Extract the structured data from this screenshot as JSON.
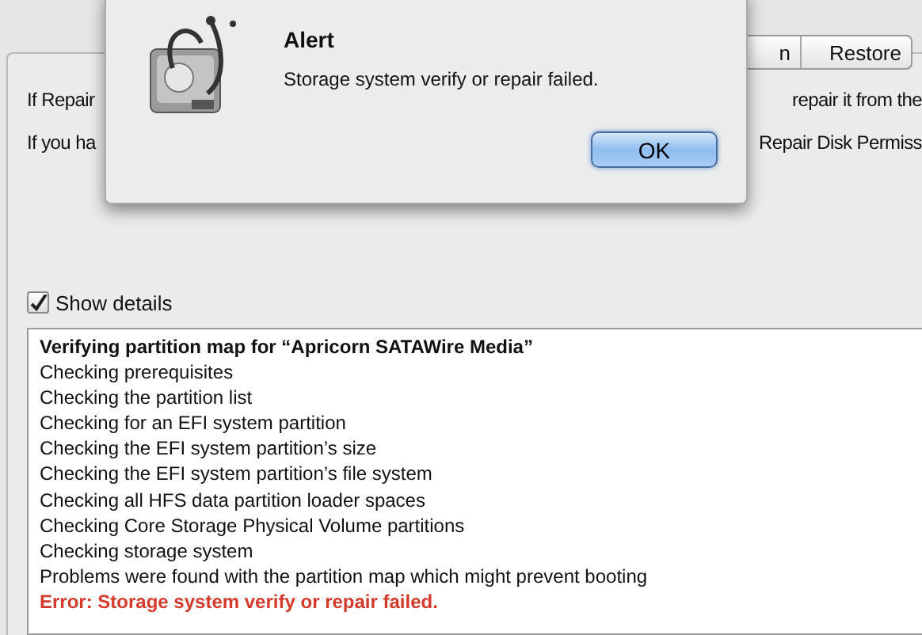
{
  "tabs": [
    {
      "label": "n",
      "selected": false
    },
    {
      "label": "Restore",
      "selected": false
    }
  ],
  "instructions": [
    {
      "left": "If Repair",
      "right": "repair it from the"
    },
    {
      "left": "If you ha",
      "right": "Repair Disk Permiss"
    }
  ],
  "show_details": {
    "label": "Show details",
    "checked": true
  },
  "log": [
    {
      "kind": "heading",
      "text": "Verifying partition map for “Apricorn SATAWire Media”"
    },
    {
      "kind": "normal",
      "text": "Checking prerequisites"
    },
    {
      "kind": "normal",
      "text": "Checking the partition list"
    },
    {
      "kind": "normal",
      "text": "Checking for an EFI system partition"
    },
    {
      "kind": "normal",
      "text": "Checking the EFI system partition’s size"
    },
    {
      "kind": "normal",
      "text": "Checking the EFI system partition’s file system"
    },
    {
      "kind": "normal",
      "text": "Checking all HFS data partition loader spaces"
    },
    {
      "kind": "normal",
      "text": "Checking Core Storage Physical Volume partitions"
    },
    {
      "kind": "normal",
      "text": "Checking storage system"
    },
    {
      "kind": "normal",
      "text": "Problems were found with the partition map which might prevent booting"
    },
    {
      "kind": "error",
      "text": "Error: Storage system verify or repair failed."
    }
  ],
  "alert": {
    "title": "Alert",
    "message": "Storage system verify or repair failed.",
    "button": "OK"
  }
}
